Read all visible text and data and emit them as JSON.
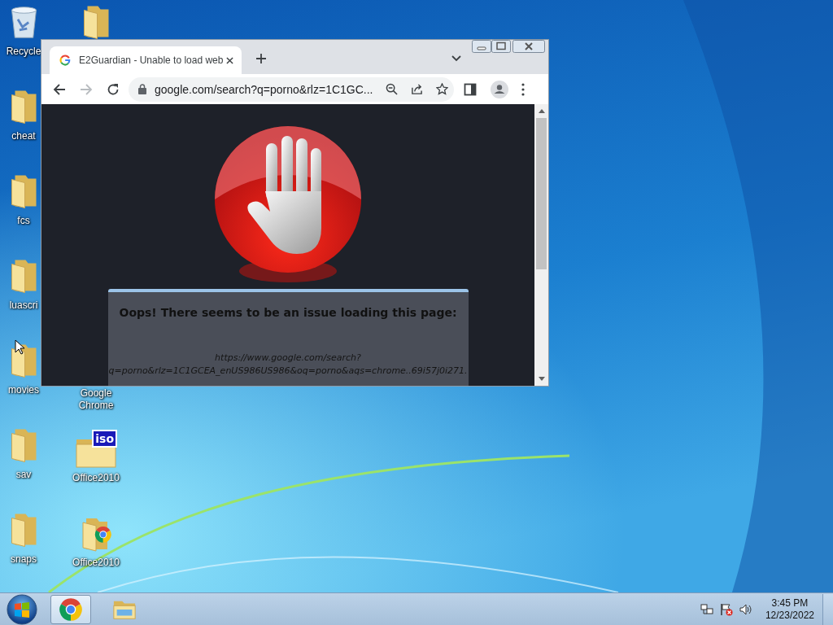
{
  "desktop_icons": {
    "columns": [
      [
        {
          "kind": "recycle-bin",
          "label": "Recycle"
        },
        {
          "kind": "folder",
          "label": "cheat"
        },
        {
          "kind": "folder",
          "label": "fcs"
        },
        {
          "kind": "folder",
          "label": "luascri"
        },
        {
          "kind": "folder",
          "label": "movies"
        },
        {
          "kind": "folder",
          "label": "sav"
        },
        {
          "kind": "folder",
          "label": "snaps"
        }
      ],
      [
        {
          "kind": "folder"
        },
        {
          "kind": "hidden",
          "label": "Google Chrome"
        },
        {
          "kind": "iso-folder",
          "badge": "iso",
          "label": "Office2010"
        },
        {
          "kind": "chrome-folder",
          "label": "Office2010"
        }
      ]
    ]
  },
  "browser": {
    "tabs": [
      {
        "title": "E2Guardian - Unable to load web",
        "selected": true
      }
    ],
    "address": "google.com/search?q=porno&rlz=1C1GC...",
    "page": {
      "heading": "Oops! There seems to be an issue loading this page:",
      "url_lines": [
        "https://www.google.com/search?",
        "q=porno&rlz=1C1GCEA_enUS986US986&oq=porno&aqs=chrome..69i57j0i271."
      ]
    }
  },
  "taskbar": {
    "items": [
      {
        "kind": "chrome",
        "active": true
      },
      {
        "kind": "explorer",
        "active": false
      }
    ],
    "time": "3:45 PM",
    "date": "12/23/2022"
  }
}
